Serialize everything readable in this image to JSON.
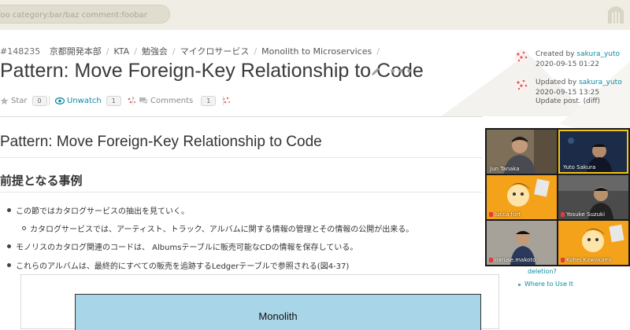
{
  "search": {
    "placeholder": "foo category:bar/baz comment:foobar"
  },
  "breadcrumb": {
    "id": "#148235",
    "items": [
      "京都開発本部",
      "KTA",
      "勉強会",
      "マイクロサービス",
      "Monolith to Microservices"
    ],
    "separator": "/"
  },
  "page": {
    "title": "Pattern: Move Foreign-Key Relationship to Code",
    "more_label": "•••"
  },
  "actions": {
    "star_label": "Star",
    "star_count": "0",
    "watch_label": "Unwatch",
    "watch_count": "1",
    "comments_label": "Comments",
    "comments_count": "1"
  },
  "meta": {
    "created_label": "Created by",
    "created_by": "sakura_yuto",
    "created_at": "2020-09-15 01:22",
    "updated_label": "Updated by",
    "updated_by": "sakura_yuto",
    "updated_at": "2020-09-15 13:25",
    "update_note": "Update post. (diff)"
  },
  "content": {
    "h1": "Pattern: Move Foreign-Key Relationship to Code",
    "h2": "前提となる事例",
    "bullets": [
      "この節ではカタログサービスの抽出を見ていく。",
      "カタログサービスでは、アーティスト、トラック、アルバムに関する情報の管理とその情報の公開が出来る。",
      "モノリスのカタログ関連のコードは、 Albumsテーブルに販売可能なCDの情報を保存している。",
      "これらのアルバムは、最終的にすべての販売を追跡するLedgerテーブルで参照される(図4-37)"
    ],
    "figure_label": "Monolith"
  },
  "toc": {
    "items": [
      "deletion?",
      "Where to Use It"
    ]
  },
  "video_call": {
    "participants": [
      {
        "name": "Jun Tanaka"
      },
      {
        "name": "Yuto Sakura"
      },
      {
        "name": "lucca fort"
      },
      {
        "name": "Yosuke Suzuki"
      },
      {
        "name": "naruse.makoto"
      },
      {
        "name": "Kohei Kawakami"
      }
    ]
  },
  "colors": {
    "accent": "#0a8ca3",
    "topbar": "#efede4",
    "figure_fill": "#a8d5e8",
    "avatar_orange": "#f39c12"
  }
}
